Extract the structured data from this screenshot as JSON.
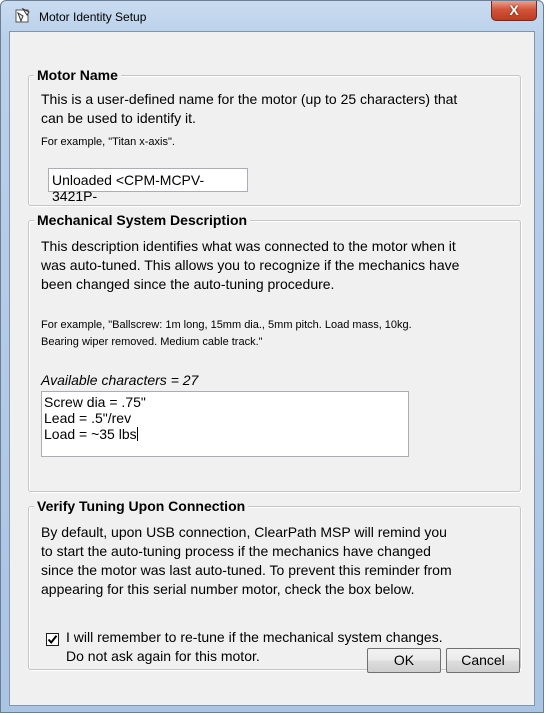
{
  "window": {
    "title": "Motor Identity Setup",
    "close_glyph": "X"
  },
  "motor_name": {
    "legend": "Motor Name",
    "desc_line1": "This is a user-defined name for the motor (up to 25 characters) that",
    "desc_line2": "can be used to identify it.",
    "example": "For example, \"Titan x-axis\".",
    "value": "Unloaded <CPM-MCPV-3421P-"
  },
  "mechanical": {
    "legend": "Mechanical System Description",
    "desc_line1": "This description identifies what was connected to the motor when it",
    "desc_line2": "was auto-tuned. This allows you to recognize if the mechanics have",
    "desc_line3": "been changed since the auto-tuning procedure.",
    "example_line1": "For example, \"Ballscrew: 1m long, 15mm dia., 5mm pitch. Load mass, 10kg.",
    "example_line2": "Bearing wiper removed. Medium cable track.\"",
    "available": "Available characters = 27",
    "lines": [
      "Screw dia = .75\"",
      "Lead = .5\"/rev",
      "Load = ~35 lbs"
    ]
  },
  "verify": {
    "legend": "Verify Tuning Upon Connection",
    "desc_line1": "By default, upon USB connection, ClearPath MSP will remind you",
    "desc_line2": "to start the auto-tuning process if the mechanics have changed",
    "desc_line3": "since the motor was last auto-tuned. To prevent this reminder from",
    "desc_line4": "appearing for this serial number motor, check the box below.",
    "checkbox_checked": true,
    "checkbox_label_line1": "I will remember to re-tune if the mechanical system changes.",
    "checkbox_label_line2": "Do not ask again for this motor."
  },
  "buttons": {
    "ok": "OK",
    "cancel": "Cancel"
  },
  "icons": {
    "title": "motor-setup-icon",
    "close": "close-icon",
    "check": "checkmark-icon"
  }
}
